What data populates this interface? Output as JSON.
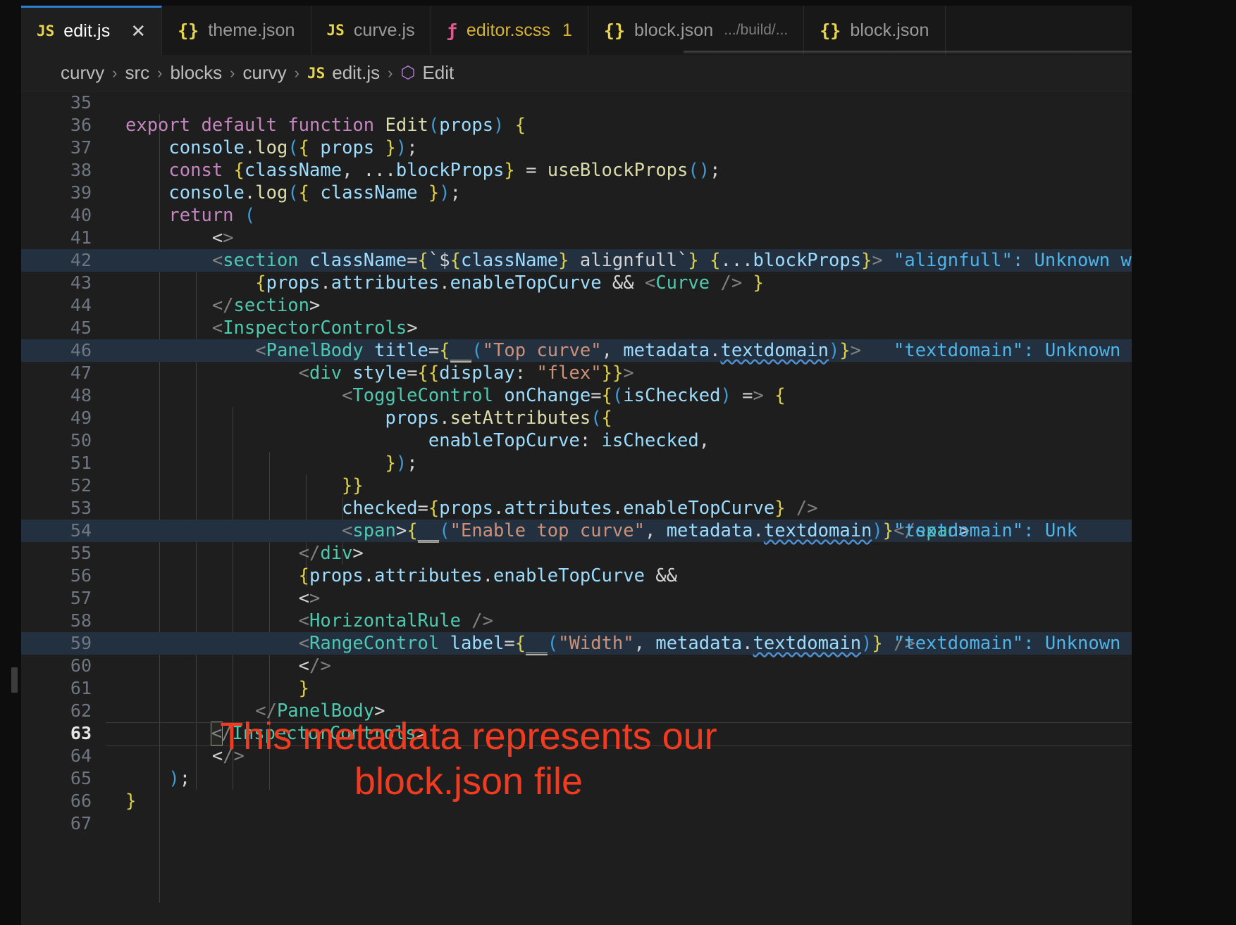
{
  "window": {
    "theme_bg": "#1e1e1e",
    "accent": "#2f7fd1"
  },
  "tabs": [
    {
      "icon": "js-file-icon",
      "icon_glyph": "JS",
      "icon_class": "ico-js",
      "label": "edit.js",
      "sub": "",
      "badge": "",
      "active": true,
      "close": "✕"
    },
    {
      "icon": "json-file-icon",
      "icon_glyph": "{}",
      "icon_class": "ico-json",
      "label": "theme.json",
      "sub": "",
      "badge": "",
      "active": false,
      "close": ""
    },
    {
      "icon": "js-file-icon",
      "icon_glyph": "JS",
      "icon_class": "ico-js",
      "label": "curve.js",
      "sub": "",
      "badge": "",
      "active": false,
      "close": ""
    },
    {
      "icon": "scss-file-icon",
      "icon_glyph": "ƒ",
      "icon_class": "ico-scss",
      "label": "editor.scss",
      "sub": "",
      "badge": "1",
      "active": false,
      "close": ""
    },
    {
      "icon": "json-file-icon",
      "icon_glyph": "{}",
      "icon_class": "ico-json",
      "label": "block.json",
      "sub": ".../build/...",
      "badge": "",
      "active": false,
      "close": ""
    },
    {
      "icon": "json-file-icon",
      "icon_glyph": "{}",
      "icon_class": "ico-json",
      "label": "block.json",
      "sub": "",
      "badge": "",
      "active": false,
      "close": ""
    }
  ],
  "breadcrumb": {
    "items": [
      "curvy",
      "src",
      "blocks",
      "curvy",
      "edit.js",
      "Edit"
    ],
    "separator": "›",
    "file_icon_glyph": "JS",
    "symbol_icon_glyph": "⬡"
  },
  "editor": {
    "first_visible_line": 35,
    "cursor_line": 63,
    "lines": [
      {
        "n": 35,
        "text": ""
      },
      {
        "n": 36,
        "text": "export default function Edit(props) {"
      },
      {
        "n": 37,
        "text": "    console.log({ props });"
      },
      {
        "n": 38,
        "text": "    const {className, ...blockProps} = useBlockProps();"
      },
      {
        "n": 39,
        "text": "    console.log({ className });"
      },
      {
        "n": 40,
        "text": "    return ("
      },
      {
        "n": 41,
        "text": "        <>"
      },
      {
        "n": 42,
        "text": "        <section className={`${className} alignfull`} {...blockProps}>",
        "hl": true,
        "inline": "\"alignfull\": Unknown word"
      },
      {
        "n": 43,
        "text": "            {props.attributes.enableTopCurve && <Curve /> }"
      },
      {
        "n": 44,
        "text": "        </section>"
      },
      {
        "n": 45,
        "text": "        <InspectorControls>"
      },
      {
        "n": 46,
        "text": "            <PanelBody title={__(\"Top curve\", metadata.textdomain)}>",
        "hl": true,
        "inline": "\"textdomain\": Unknown word."
      },
      {
        "n": 47,
        "text": "                <div style={{display: \"flex\"}}>"
      },
      {
        "n": 48,
        "text": "                    <ToggleControl onChange={(isChecked) => {"
      },
      {
        "n": 49,
        "text": "                        props.setAttributes({"
      },
      {
        "n": 50,
        "text": "                            enableTopCurve: isChecked,"
      },
      {
        "n": 51,
        "text": "                        });"
      },
      {
        "n": 52,
        "text": "                    }}"
      },
      {
        "n": 53,
        "text": "                    checked={props.attributes.enableTopCurve} />"
      },
      {
        "n": 54,
        "text": "                    <span>{__(\"Enable top curve\", metadata.textdomain)}</span>",
        "hl": true,
        "inline": "\"textdomain\": Unk"
      },
      {
        "n": 55,
        "text": "                </div>"
      },
      {
        "n": 56,
        "text": "                {props.attributes.enableTopCurve &&"
      },
      {
        "n": 57,
        "text": "                <>"
      },
      {
        "n": 58,
        "text": "                <HorizontalRule />"
      },
      {
        "n": 59,
        "text": "                <RangeControl label={__(\"Width\", metadata.textdomain)} />",
        "hl": true,
        "inline": "\"textdomain\": Unknown"
      },
      {
        "n": 60,
        "text": "                </>"
      },
      {
        "n": 61,
        "text": "                }"
      },
      {
        "n": 62,
        "text": "            </PanelBody>"
      },
      {
        "n": 63,
        "text": "        </InspectorControls>",
        "cursor": true
      },
      {
        "n": 64,
        "text": "        </>"
      },
      {
        "n": 65,
        "text": "    );"
      },
      {
        "n": 66,
        "text": "}"
      },
      {
        "n": 67,
        "text": ""
      }
    ]
  },
  "annotation": {
    "text": "This metadata represents our block.json file",
    "color": "#f03b20"
  }
}
